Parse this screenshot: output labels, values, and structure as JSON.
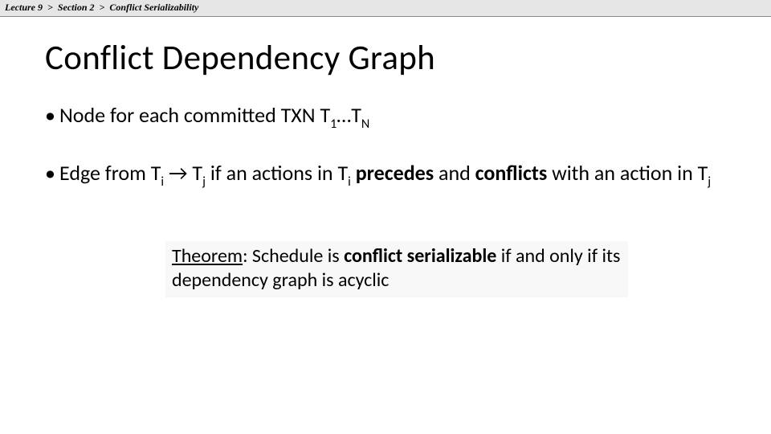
{
  "breadcrumb": {
    "lecture": "Lecture 9",
    "sep1": ">",
    "section": "Section 2",
    "sep2": ">",
    "topic": "Conflict Serializability"
  },
  "title": "Conflict Dependency Graph",
  "bullets": {
    "b1_pre": "Node for each committed TXN T",
    "b1_sub1": "1",
    "b1_mid": "…T",
    "b1_sub2": "N",
    "b2_pre": "Edge from T",
    "b2_sub1": "i",
    "b2_arrow": " → T",
    "b2_sub2": "j",
    "b2_mid": " if an actions in T",
    "b2_sub3": "i",
    "b2_space": " ",
    "b2_pc1": "precedes",
    "b2_and": " and ",
    "b2_pc2": "conflicts",
    "b2_tail1": " with an action in T",
    "b2_sub4": "j"
  },
  "theorem": {
    "label": "Theorem",
    "colon": ": Schedule is ",
    "strong": "conflict serializable",
    "rest": " if and only if its dependency graph is acyclic"
  }
}
